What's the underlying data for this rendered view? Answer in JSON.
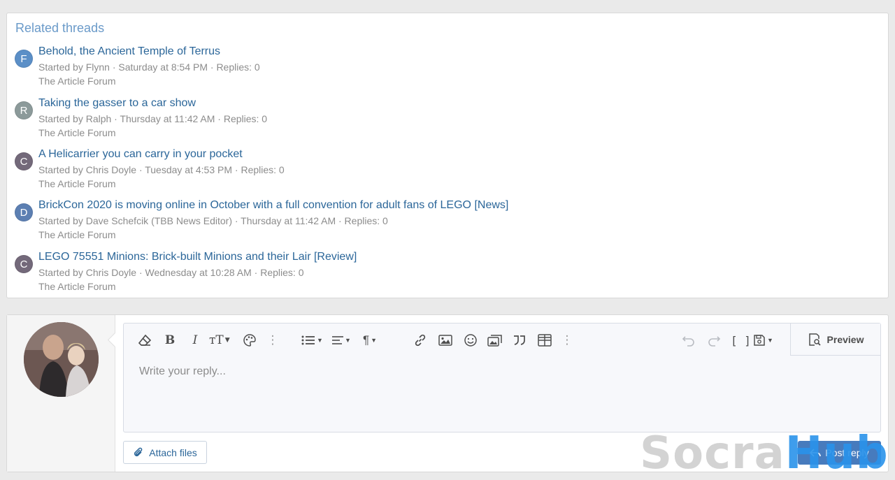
{
  "related": {
    "title": "Related threads",
    "threads": [
      {
        "initial": "F",
        "avatar_color": "#5b8fc7",
        "title": "Behold, the Ancient Temple of Terrus",
        "meta": "Started by Flynn · Saturday at 8:54 PM · Replies: 0",
        "forum": "The Article Forum"
      },
      {
        "initial": "R",
        "avatar_color": "#8c9a9a",
        "title": "Taking the gasser to a car show",
        "meta": "Started by Ralph · Thursday at 11:42 AM · Replies: 0",
        "forum": "The Article Forum"
      },
      {
        "initial": "C",
        "avatar_color": "#73697a",
        "title": "A Helicarrier you can carry in your pocket",
        "meta": "Started by Chris Doyle · Tuesday at 4:53 PM · Replies: 0",
        "forum": "The Article Forum"
      },
      {
        "initial": "D",
        "avatar_color": "#5c7fb2",
        "title": "BrickCon 2020 is moving online in October with a full convention for adult fans of LEGO [News]",
        "meta": "Started by Dave Schefcik (TBB News Editor) · Thursday at 11:42 AM · Replies: 0",
        "forum": "The Article Forum"
      },
      {
        "initial": "C",
        "avatar_color": "#73697a",
        "title": "LEGO 75551 Minions: Brick-built Minions and their Lair [Review]",
        "meta": "Started by Chris Doyle · Wednesday at 10:28 AM · Replies: 0",
        "forum": "The Article Forum"
      }
    ]
  },
  "reply": {
    "placeholder": "Write your reply...",
    "preview_label": "Preview",
    "attach_label": "Attach files",
    "post_label": "Post reply"
  },
  "toolbar_icons": [
    "eraser-icon",
    "bold-icon",
    "italic-icon",
    "text-size-icon",
    "palette-icon",
    "more-icon",
    "list-icon",
    "align-icon",
    "paragraph-icon",
    "link-icon",
    "image-icon",
    "smilie-icon",
    "media-icon",
    "quote-icon",
    "table-icon",
    "more-icon",
    "undo-icon",
    "redo-icon",
    "bbcode-icon",
    "drafts-icon"
  ],
  "watermark": {
    "part1": "Socra",
    "part2": "Hub"
  }
}
